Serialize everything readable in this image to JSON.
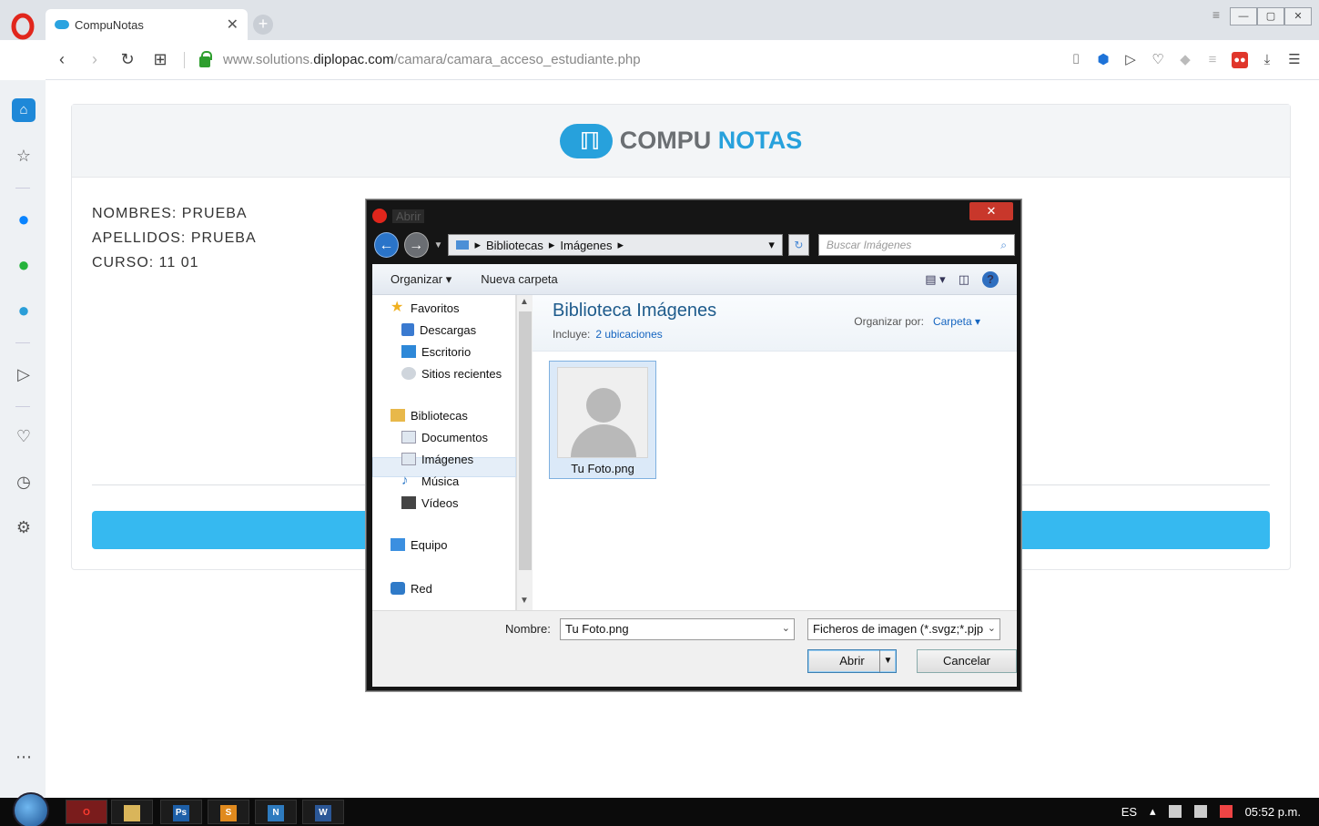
{
  "browser": {
    "tab_title": "CompuNotas",
    "tab_close": "✕",
    "new_tab": "+",
    "url_prefix": "www.solutions.",
    "url_domain": "diplopac.com",
    "url_path": "/camara/camara_acceso_estudiante.php"
  },
  "page": {
    "logo_part1": "COMPU",
    "logo_part2": "NOTAS",
    "nombres": "NOMBRES: PRUEBA",
    "apellidos": "APELLIDOS: PRUEBA",
    "curso": "CURSO: 11 01"
  },
  "dialog": {
    "title": "Abrir",
    "close": "✕",
    "breadcrumb": [
      "Bibliotecas",
      "Imágenes"
    ],
    "search_placeholder": "Buscar Imágenes",
    "toolbar": {
      "organize": "Organizar ▾",
      "new_folder": "Nueva carpeta"
    },
    "nav": {
      "favorites": "Favoritos",
      "downloads": "Descargas",
      "desktop": "Escritorio",
      "recent": "Sitios recientes",
      "libraries": "Bibliotecas",
      "documents": "Documentos",
      "images": "Imágenes",
      "music": "Música",
      "videos": "Vídeos",
      "computer": "Equipo",
      "network": "Red"
    },
    "library": {
      "title": "Biblioteca Imágenes",
      "includes_label": "Incluye:",
      "includes_link": "2 ubicaciones",
      "arrange_label": "Organizar por:",
      "arrange_value": "Carpeta ▾"
    },
    "file": {
      "name": "Tu Foto.png"
    },
    "filename_label": "Nombre:",
    "filename_value": "Tu Foto.png",
    "filetype_value": "Ficheros de imagen (*.svgz;*.pjp",
    "open_button": "Abrir",
    "cancel_button": "Cancelar"
  },
  "taskbar": {
    "lang": "ES",
    "clock": "05:52 p.m."
  },
  "colors": {
    "accent": "#27a1dc",
    "bluebar": "#36b9f0",
    "dialog_frame": "#151515",
    "close_red": "#c8372b"
  }
}
